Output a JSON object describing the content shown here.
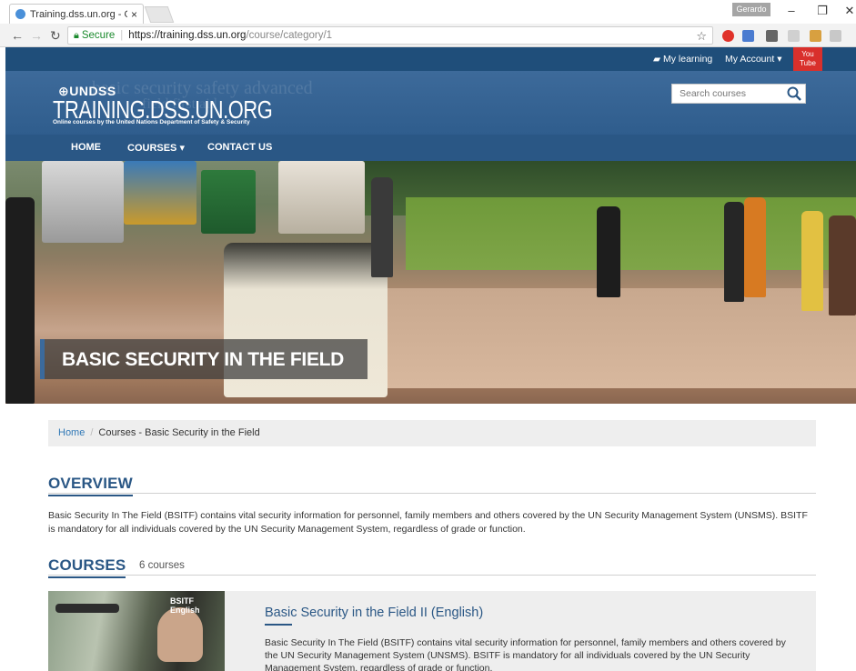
{
  "browser": {
    "tab_title": "Training.dss.un.org - Onl",
    "tab_close": "×",
    "profile_name": "Gerardo",
    "secure_label": "Secure",
    "url_host": "https://training.dss.un.org",
    "url_path": "/course/category/1",
    "icons": [
      "back-icon",
      "forward-icon",
      "reload-icon",
      "lock-icon",
      "star-icon"
    ]
  },
  "topbar": {
    "my_learning": "My learning",
    "my_account": "My Account ▾",
    "youtube_top": "You",
    "youtube_bottom": "Tube"
  },
  "header": {
    "logo_small": "⊕UNDSS",
    "logo_big": "TRAINING.DSS.UN.ORG",
    "logo_sub": "Online courses by the United Nations Department of Safety & Security",
    "search_placeholder": "Search courses"
  },
  "nav": {
    "home": "HOME",
    "courses": "COURSES ▾",
    "contact": "CONTACT US"
  },
  "hero": {
    "title": "BASIC SECURITY IN THE FIELD"
  },
  "breadcrumb": {
    "home": "Home",
    "separator": "/",
    "current": "Courses - Basic Security in the Field"
  },
  "overview": {
    "heading": "OVERVIEW",
    "text": "Basic Security In The Field (BSITF) contains vital security information for personnel, family members and others covered by the UN Security Management System (UNSMS). BSITF is mandatory for all individuals covered by the UN Security Management System, regardless of grade or function."
  },
  "courses": {
    "heading": "COURSES",
    "count": "6 courses",
    "items": [
      {
        "thumb_tag": "BSITF English",
        "title": "Basic Security in the Field II (English)",
        "description": "Basic Security In The Field (BSITF) contains vital security information for personnel, family members and others covered by the UN Security Management System (UNSMS). BSITF is mandatory for all individuals covered by the UN Security Management System, regardless of grade or function."
      }
    ]
  },
  "colors": {
    "brand_dark": "#1f4e7a",
    "brand": "#2a5785",
    "link": "#337ab7"
  }
}
